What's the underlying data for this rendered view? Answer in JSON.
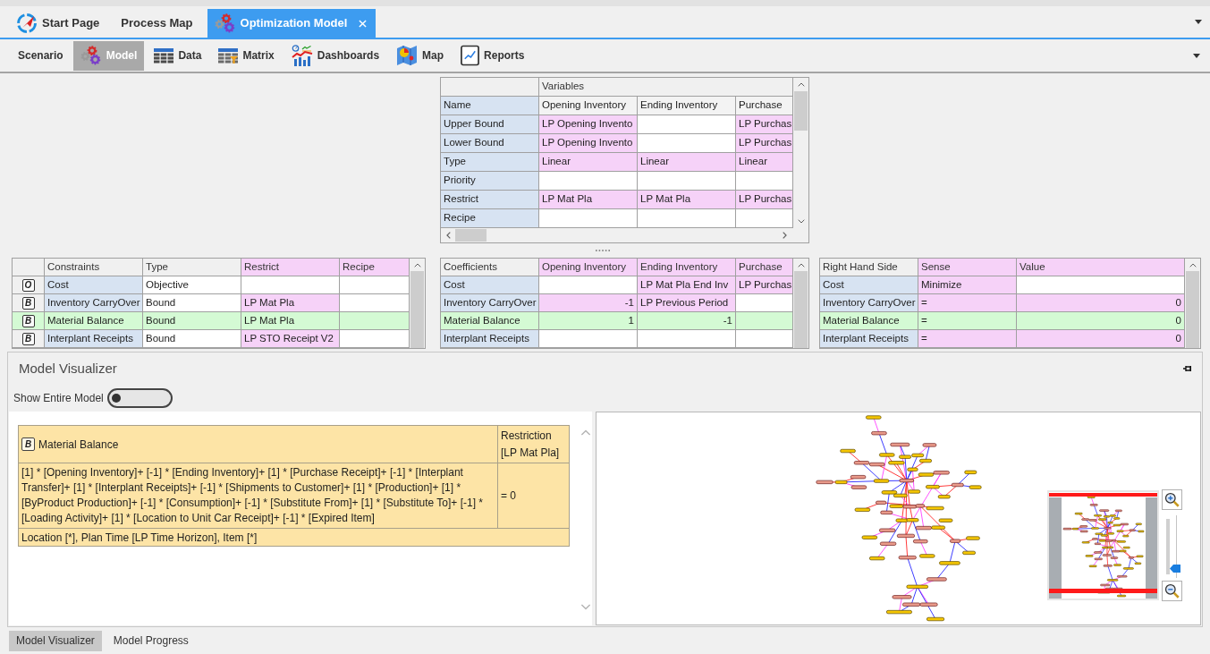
{
  "document_tabs": [
    {
      "label": "Start Page",
      "kind": "start",
      "selected": false
    },
    {
      "label": "Process Map",
      "kind": "document",
      "selected": false
    },
    {
      "label": "Optimization Model",
      "kind": "model",
      "selected": true
    }
  ],
  "toolbar": [
    {
      "label": "Scenario",
      "kind": "text",
      "selected": false
    },
    {
      "label": "Model",
      "kind": "model",
      "selected": true
    },
    {
      "label": "Data",
      "kind": "data",
      "selected": false
    },
    {
      "label": "Matrix",
      "kind": "matrix",
      "selected": false
    },
    {
      "label": "Dashboards",
      "kind": "dashboards",
      "selected": false
    },
    {
      "label": "Map",
      "kind": "map",
      "selected": false
    },
    {
      "label": "Reports",
      "kind": "reports",
      "selected": false
    }
  ],
  "variables_grid": {
    "title": "Variables",
    "header_label": "Name",
    "columns": [
      "Opening Inventory",
      "Ending Inventory",
      "Purchase"
    ],
    "rows": [
      {
        "label": "Upper Bound",
        "cells": [
          {
            "text": "LP Opening Invento",
            "highlighted": true
          },
          {
            "highlighted": false
          },
          {
            "text": "LP Purchas",
            "highlighted": true
          }
        ]
      },
      {
        "label": "Lower Bound",
        "cells": [
          {
            "text": "LP Opening Invento",
            "highlighted": true
          },
          {
            "highlighted": false
          },
          {
            "text": "LP Purchas",
            "highlighted": true
          }
        ]
      },
      {
        "label": "Type",
        "cells": [
          {
            "text": "Linear",
            "highlighted": true
          },
          {
            "text": "Linear",
            "highlighted": true
          },
          {
            "text": "Linear",
            "highlighted": true
          }
        ]
      },
      {
        "label": "Priority",
        "cells": [
          {
            "highlighted": false
          },
          {
            "highlighted": false
          },
          {
            "highlighted": false
          }
        ]
      },
      {
        "label": "Restrict",
        "cells": [
          {
            "text": "LP Mat Pla",
            "highlighted": true
          },
          {
            "text": "LP Mat Pla",
            "highlighted": true
          },
          {
            "text": "LP Purchas",
            "highlighted": true
          }
        ]
      },
      {
        "label": "Recipe",
        "cells": [
          {
            "highlighted": false
          },
          {
            "highlighted": false
          },
          {
            "highlighted": false
          }
        ]
      }
    ]
  },
  "constraints_grid": {
    "header_label": "Constraints",
    "columns": [
      {
        "label": "Type",
        "highlighted": false
      },
      {
        "label": "Restrict",
        "highlighted": true
      },
      {
        "label": "Recipe",
        "highlighted": true
      }
    ],
    "rows": [
      {
        "badge": "O",
        "label": "Cost",
        "selected": false,
        "cells": [
          {
            "text": "Objective",
            "highlighted": false
          },
          {
            "highlighted": false
          },
          {
            "highlighted": false
          }
        ]
      },
      {
        "badge": "B",
        "label": "Inventory CarryOver",
        "selected": false,
        "cells": [
          {
            "text": "Bound",
            "highlighted": false
          },
          {
            "text": "LP Mat Pla",
            "highlighted": true
          },
          {
            "highlighted": false
          }
        ]
      },
      {
        "badge": "B",
        "label": "Material Balance",
        "selected": true,
        "cells": [
          {
            "text": "Bound"
          },
          {
            "text": "LP Mat Pla"
          }
        ]
      },
      {
        "badge": "B",
        "label": "Interplant Receipts",
        "selected": false,
        "cells": [
          {
            "text": "Bound",
            "highlighted": false
          },
          {
            "text": "LP STO Receipt V2",
            "highlighted": true
          },
          {
            "highlighted": false
          }
        ]
      }
    ]
  },
  "coefficients_grid": {
    "header_label": "Coefficients",
    "columns": [
      {
        "label": "Opening Inventory",
        "highlighted": true
      },
      {
        "label": "Ending Inventory",
        "highlighted": true
      },
      {
        "label": "Purchase",
        "highlighted": true
      }
    ],
    "rows": [
      {
        "label": "Cost",
        "selected": false,
        "cells": [
          {
            "highlighted": false
          },
          {
            "kind": "text",
            "text": "LP Mat Pla End Inv",
            "highlighted": true
          },
          {
            "kind": "text",
            "text": "LP Purchas",
            "highlighted": true
          }
        ]
      },
      {
        "label": "Inventory CarryOver",
        "selected": false,
        "cells": [
          {
            "kind": "number",
            "text": "-1",
            "highlighted": true
          },
          {
            "kind": "text",
            "text": "LP Previous Period",
            "highlighted": true
          },
          {
            "highlighted": false
          }
        ]
      },
      {
        "label": "Material Balance",
        "selected": true,
        "cells": [
          {
            "kind": "number",
            "text": "1"
          },
          {
            "kind": "number",
            "text": "-1"
          }
        ]
      },
      {
        "label": "Interplant Receipts",
        "selected": false,
        "cells": [
          {
            "highlighted": false
          },
          {
            "highlighted": false
          },
          {
            "highlighted": false
          }
        ]
      }
    ]
  },
  "rhs_grid": {
    "header_label": "Right Hand Side",
    "columns": [
      {
        "label": "Sense",
        "highlighted": true
      },
      {
        "label": "Value",
        "highlighted": true
      }
    ],
    "rows": [
      {
        "label": "Cost",
        "selected": false,
        "cells": [
          {
            "kind": "text",
            "text": "Minimize",
            "highlighted": true
          },
          {
            "highlighted": false
          }
        ]
      },
      {
        "label": "Inventory CarryOver",
        "selected": false,
        "cells": [
          {
            "kind": "text",
            "text": "=",
            "highlighted": true
          },
          {
            "kind": "number",
            "text": "0",
            "highlighted": true
          }
        ]
      },
      {
        "label": "Material Balance",
        "selected": true,
        "cells": [
          {
            "kind": "text",
            "text": "="
          },
          {
            "kind": "number",
            "text": "0"
          }
        ]
      },
      {
        "label": "Interplant Receipts",
        "selected": false,
        "cells": [
          {
            "kind": "text",
            "text": "=",
            "highlighted": true
          },
          {
            "kind": "number",
            "text": "0",
            "highlighted": true
          }
        ]
      }
    ]
  },
  "visualizer": {
    "title": "Model Visualizer",
    "toggle": {
      "label": "Show Entire Model",
      "on": false
    },
    "expression": {
      "badge": "B",
      "name": "Material Balance",
      "restriction": "Restriction [LP Mat Pla]",
      "formula": "[1] * [Opening Inventory]+ [-1] * [Ending Inventory]+ [1] * [Purchase Receipt]+ [-1] * [Interplant Transfer]+ [1] * [Interplant Receipts]+ [-1] * [Shipments to Customer]+ [1] * [Production]+ [1] * [ByProduct Production]+ [-1] * [Consumption]+ [-1] * [Substitute From]+ [1] * [Substitute To]+ [-1] * [Loading Activity]+ [1] * [Location to Unit Car Receipt]+ [-1] * [Expired Item]",
      "result": "= 0",
      "dimensions": "Location [*], Plan Time [LP Time Horizon], Item [*]"
    },
    "zoom": {
      "level": 0.1
    }
  },
  "bottom_tabs": [
    {
      "label": "Model Visualizer",
      "selected": true
    },
    {
      "label": "Model Progress",
      "selected": false
    }
  ]
}
